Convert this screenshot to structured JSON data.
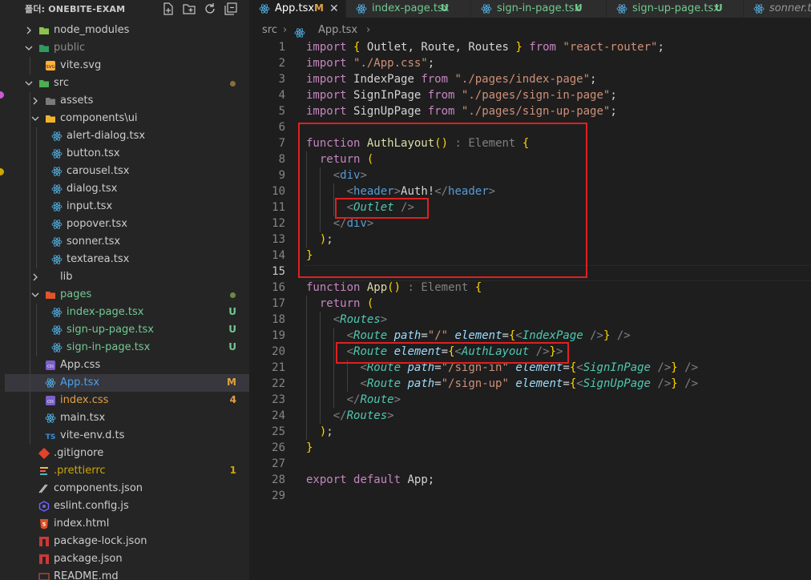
{
  "colors": {
    "sidebar_bg": "#252526",
    "editor_bg": "#1e1e1e",
    "git_untracked": "#73c991",
    "git_modified": "#e2a041",
    "annotation_red": "#e02020"
  },
  "explorer": {
    "title": "폴더: ONEBITE-EXAM",
    "actions": [
      "new-file-icon",
      "new-folder-icon",
      "refresh-icon",
      "collapse-icon"
    ]
  },
  "tree": [
    {
      "label": "node_modules",
      "type": "folder",
      "expanded": false,
      "icon": "node-folder-icon"
    },
    {
      "label": "public",
      "type": "folder",
      "expanded": true,
      "icon": "public-folder-icon"
    },
    {
      "label": "vite.svg",
      "type": "file",
      "icon": "svg-file-icon"
    },
    {
      "label": "src",
      "type": "folder",
      "expanded": true,
      "icon": "src-folder-icon"
    },
    {
      "label": "assets",
      "type": "folder",
      "expanded": false,
      "icon": "assets-folder-icon"
    },
    {
      "label": "components\\ui",
      "type": "folder",
      "expanded": true,
      "icon": "components-folder-icon"
    },
    {
      "label": "alert-dialog.tsx",
      "type": "file",
      "icon": "react-icon"
    },
    {
      "label": "button.tsx",
      "type": "file",
      "icon": "react-icon"
    },
    {
      "label": "carousel.tsx",
      "type": "file",
      "icon": "react-icon"
    },
    {
      "label": "dialog.tsx",
      "type": "file",
      "icon": "react-icon"
    },
    {
      "label": "input.tsx",
      "type": "file",
      "icon": "react-icon"
    },
    {
      "label": "popover.tsx",
      "type": "file",
      "icon": "react-icon"
    },
    {
      "label": "sonner.tsx",
      "type": "file",
      "icon": "react-icon"
    },
    {
      "label": "textarea.tsx",
      "type": "file",
      "icon": "react-icon"
    },
    {
      "label": "lib",
      "type": "folder",
      "expanded": false,
      "icon": "lib-folder-icon"
    },
    {
      "label": "pages",
      "type": "folder",
      "expanded": true,
      "icon": "pages-folder-icon"
    },
    {
      "label": "index-page.tsx",
      "type": "file",
      "icon": "react-icon",
      "status": "U"
    },
    {
      "label": "sign-up-page.tsx",
      "type": "file",
      "icon": "react-icon",
      "status": "U"
    },
    {
      "label": "sign-in-page.tsx",
      "type": "file",
      "icon": "react-icon",
      "status": "U"
    },
    {
      "label": "App.css",
      "type": "file",
      "icon": "css-icon"
    },
    {
      "label": "App.tsx",
      "type": "file",
      "icon": "react-icon",
      "status": "M"
    },
    {
      "label": "index.css",
      "type": "file",
      "icon": "css-icon",
      "status": "4"
    },
    {
      "label": "main.tsx",
      "type": "file",
      "icon": "react-icon"
    },
    {
      "label": "vite-env.d.ts",
      "type": "file",
      "icon": "ts-icon"
    },
    {
      "label": ".gitignore",
      "type": "file",
      "icon": "git-icon"
    },
    {
      "label": ".prettierrc",
      "type": "file",
      "icon": "prettier-icon",
      "status": "1"
    },
    {
      "label": "components.json",
      "type": "file",
      "icon": "json-slash-icon"
    },
    {
      "label": "eslint.config.js",
      "type": "file",
      "icon": "eslint-icon"
    },
    {
      "label": "index.html",
      "type": "file",
      "icon": "html-icon"
    },
    {
      "label": "package-lock.json",
      "type": "file",
      "icon": "npm-icon"
    },
    {
      "label": "package.json",
      "type": "file",
      "icon": "npm-icon"
    },
    {
      "label": "README.md",
      "type": "file",
      "icon": "markdown-icon"
    }
  ],
  "tabs": [
    {
      "label": "App.tsx",
      "status": "M",
      "active": true
    },
    {
      "label": "index-page.tsx",
      "status": "U",
      "active": false
    },
    {
      "label": "sign-in-page.tsx",
      "status": "U",
      "active": false
    },
    {
      "label": "sign-up-page.tsx",
      "status": "U",
      "active": false
    },
    {
      "label": "sonner.tsx",
      "status": "",
      "active": false
    }
  ],
  "breadcrumb": {
    "folder": "src",
    "separator": "›",
    "file": "App.tsx"
  },
  "editor": {
    "current_line": 15,
    "line_numbers": [
      "1",
      "2",
      "3",
      "4",
      "5",
      "6",
      "7",
      "8",
      "9",
      "10",
      "11",
      "12",
      "13",
      "14",
      "15",
      "16",
      "17",
      "18",
      "19",
      "20",
      "21",
      "22",
      "23",
      "24",
      "25",
      "26",
      "27",
      "28",
      "29"
    ],
    "lines": [
      "import { Outlet, Route, Routes } from \"react-router\";",
      "import \"./App.css\";",
      "import IndexPage from \"./pages/index-page\";",
      "import SignInPage from \"./pages/sign-in-page\";",
      "import SignUpPage from \"./pages/sign-up-page\";",
      "",
      "function AuthLayout() : Element {",
      "  return (",
      "    <div>",
      "      <header>Auth!</header>",
      "      <Outlet />",
      "    </div>",
      "  );",
      "}",
      "",
      "function App() : Element {",
      "  return (",
      "    <Routes>",
      "      <Route path=\"/\" element={<IndexPage />} />",
      "      <Route element={<AuthLayout />}>",
      "        <Route path=\"/sign-in\" element={<SignInPage />} />",
      "        <Route path=\"/sign-up\" element={<SignUpPage />} />",
      "      </Route>",
      "    </Routes>",
      "  );",
      "}",
      "",
      "export default App;",
      ""
    ]
  }
}
